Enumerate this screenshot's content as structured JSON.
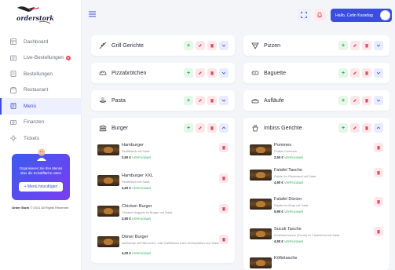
{
  "brand": {
    "logo_text": "orderstork",
    "footer_name": "Order Stork",
    "footer_copyright": "© 2021 All Rights Reserved"
  },
  "sidebar": {
    "items": [
      {
        "label": "Dashboard",
        "icon": "dashboard-icon"
      },
      {
        "label": "Live-Bestellungen",
        "icon": "live-orders-icon",
        "badge": true
      },
      {
        "label": "Bestellungen",
        "icon": "orders-icon"
      },
      {
        "label": "Restaurant",
        "icon": "restaurant-icon"
      },
      {
        "label": "Menü",
        "icon": "menu-icon",
        "active": true
      },
      {
        "label": "Finanzen",
        "icon": "finance-icon"
      },
      {
        "label": "Tickets",
        "icon": "tickets-icon"
      }
    ],
    "promo": {
      "text": "Organisieren Sie Ihre Menüs über die Schaltfläche unten",
      "button": "+ Menü hinzufügen"
    }
  },
  "header": {
    "user_greeting": "Hallo, Cetin Karadag"
  },
  "categories": [
    {
      "name": "Grill Gerichte",
      "icon": "skewer-icon",
      "expanded": false
    },
    {
      "name": "Pizzen",
      "icon": "pizza-icon",
      "expanded": false
    },
    {
      "name": "Pizzabrötchen",
      "icon": "bread-icon",
      "expanded": false
    },
    {
      "name": "Baguette",
      "icon": "baguette-icon",
      "expanded": false
    },
    {
      "name": "Pasta",
      "icon": "pasta-icon",
      "expanded": false
    },
    {
      "name": "Aufläufe",
      "icon": "casserole-icon",
      "expanded": false
    },
    {
      "name": "Burger",
      "icon": "burger-icon",
      "expanded": true
    },
    {
      "name": "Imbiss Gerichte",
      "icon": "snack-icon",
      "expanded": true
    }
  ],
  "burger_items": [
    {
      "name": "Hamburger",
      "desc": "Rindfleisch mit Salat.",
      "price": "3,50 €",
      "status": "VERFÜGBAR"
    },
    {
      "name": "Hamburger XXL",
      "desc": "Rindfleisch mit Salat.",
      "price": "4,50 €",
      "status": "VERFÜGBAR"
    },
    {
      "name": "Chicken Burger",
      "desc": "Chicken Nuggets im Burger mit Salat.",
      "price": "3,50 €",
      "status": "VERFÜGBAR"
    },
    {
      "name": "Döner Burger",
      "desc": "wahlweise mit Hähnchen- oder Kalbfleisch nach Dreheplatten und Salat.",
      "price": "4,00 €",
      "status": "VERFÜGBAR"
    }
  ],
  "imbiss_items": [
    {
      "name": "Pommes",
      "desc": "Portion Pommes.",
      "price": "2,50 €",
      "status": "VERFÜGBAR"
    },
    {
      "name": "Falafel Tasche",
      "desc": "Falafel im Fladenbrot mit Salat.",
      "price": "4,90 €",
      "status": "VERFÜGBAR"
    },
    {
      "name": "Falafel Dürüm",
      "desc": "Falafel im Wrap mit Salat.",
      "price": "5,90 €",
      "status": "VERFÜGBAR"
    },
    {
      "name": "Sucuk Tasche",
      "desc": "Knoblauchwurst (Sucuk) im Fladenbrot mit Salat.",
      "price": "4,90 €",
      "status": "VERFÜGBAR"
    },
    {
      "name": "Köftetasche",
      "desc": "",
      "price": "",
      "status": ""
    }
  ],
  "colors": {
    "accent": "#3b4de0",
    "add": "#27a552",
    "danger": "#e3405a",
    "available": "#27a552"
  }
}
